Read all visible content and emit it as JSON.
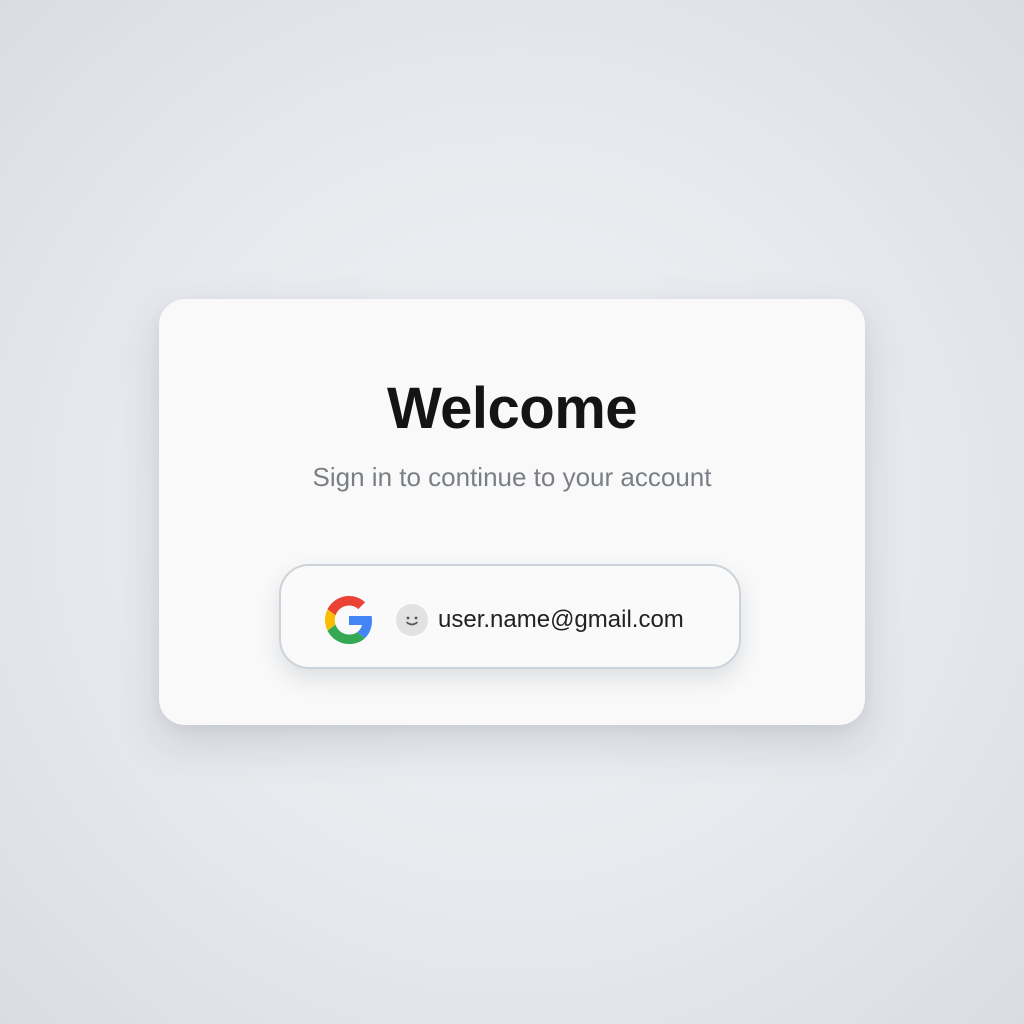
{
  "card": {
    "title": "Welcome",
    "subtitle": "Sign in to continue to your account"
  },
  "account_button": {
    "provider_icon": "google-logo-icon",
    "avatar_icon": "smiley-avatar-icon",
    "email": "user.name@gmail.com"
  },
  "colors": {
    "background": "#e6e9ed",
    "card": "#f9f9f9",
    "title": "#141414",
    "subtitle": "#7a7f86",
    "button_border": "#cdd3db",
    "google_blue": "#4285F4",
    "google_red": "#EA4335",
    "google_yellow": "#FBBC05",
    "google_green": "#34A853"
  }
}
